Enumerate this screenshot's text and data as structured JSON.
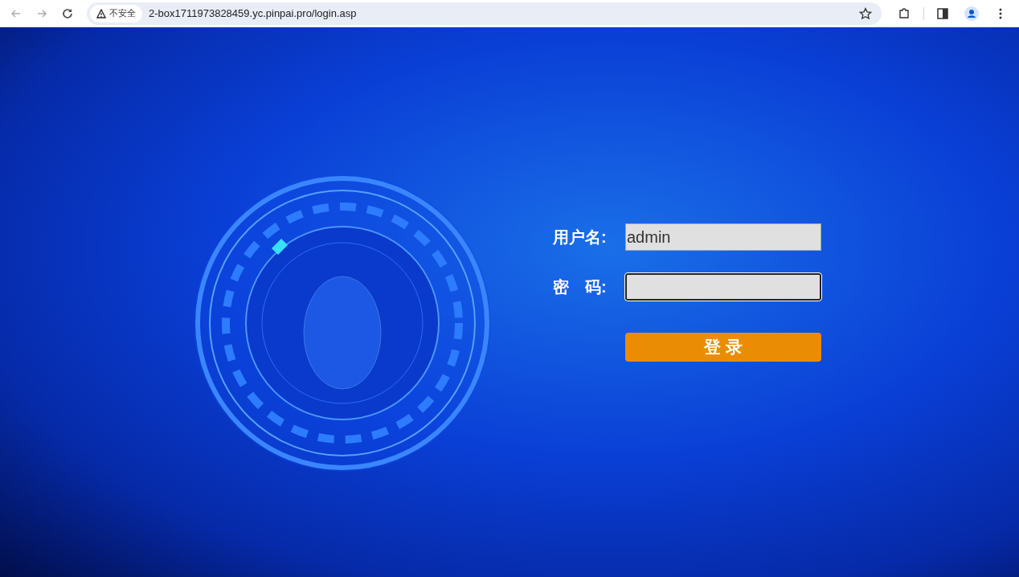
{
  "browser": {
    "security_label": "不安全",
    "url": "2-box1711973828459.yc.pinpai.pro/login.asp"
  },
  "login_form": {
    "fields": [
      {
        "label": "用户名:",
        "value": "admin",
        "focused": false
      },
      {
        "label": "密　码:",
        "focused": true
      }
    ],
    "submit": "登 录"
  }
}
